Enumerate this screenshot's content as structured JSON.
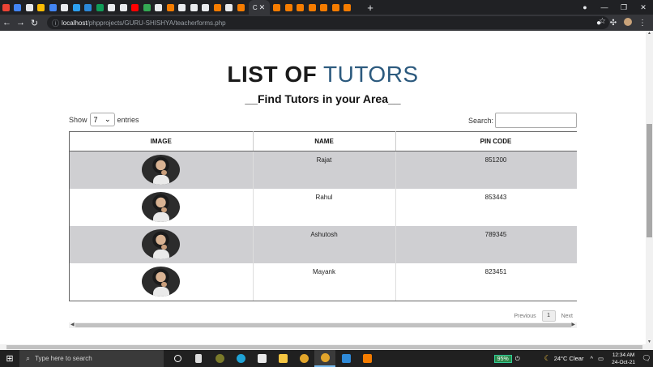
{
  "browser": {
    "url_host": "localhost",
    "url_path": "/phpprojects/GURU-SHISHYA/teacherforms.php",
    "tab_colors": [
      "#ea4335",
      "#4285f4",
      "#e8eaed",
      "#fbbc04",
      "#4285f4",
      "#e8eaed",
      "#2da0f0",
      "#2b88d8",
      "#0f9d58",
      "#e8eaed",
      "#e8eaed",
      "#ff0000",
      "#34a853",
      "#e8eaed",
      "#f57c00",
      "#e8eaed",
      "#e8eaed",
      "#e8eaed",
      "#f57c00",
      "#e8eaed",
      "#f57c00",
      "#f57c00",
      "#f57c00",
      "#f57c00",
      "#f57c00",
      "#f57c00",
      "#f57c00",
      "#f57c00"
    ],
    "active_tab_title": "C",
    "active_tab_close": "✕",
    "new_tab": "+"
  },
  "page": {
    "title_bold": "LIST OF",
    "title_light": "TUTORS",
    "subtitle": "__Find Tutors in your Area__"
  },
  "controls": {
    "show_label": "Show",
    "entries_value": "7",
    "entries_label": "entries",
    "search_label": "Search:",
    "search_value": ""
  },
  "table": {
    "headers": [
      "IMAGE",
      "NAME",
      "PIN CODE"
    ],
    "rows": [
      {
        "name": "Rajat",
        "pin": "851200"
      },
      {
        "name": "Rahul",
        "pin": "853443"
      },
      {
        "name": "Ashutosh",
        "pin": "789345"
      },
      {
        "name": "Mayank",
        "pin": "823451"
      }
    ]
  },
  "pagination": {
    "previous": "Previous",
    "current": "1",
    "next": "Next"
  },
  "taskbar": {
    "search_placeholder": "Type here to search",
    "battery": "95%",
    "weather": "24°C  Clear",
    "time": "12:34 AM",
    "date": "24-Oct-21"
  }
}
